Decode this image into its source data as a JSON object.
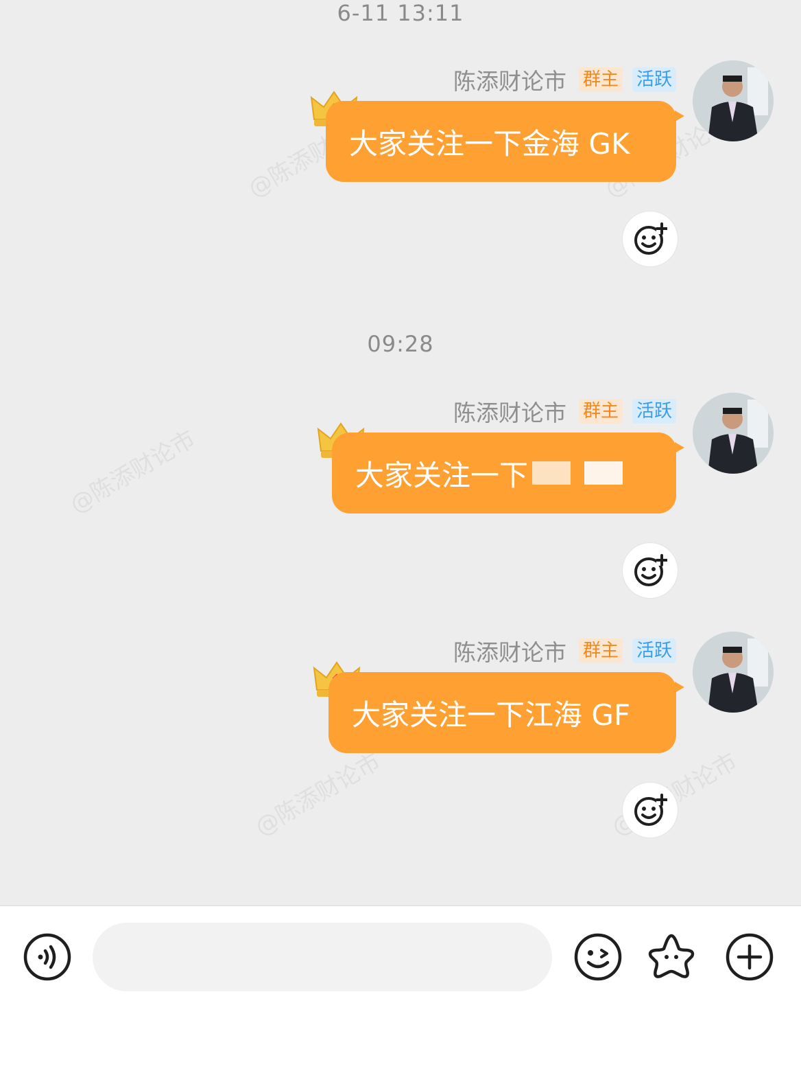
{
  "watermark_text": "@陈添财论市",
  "messages": [
    {
      "time": "6-11 13:11",
      "sender": "陈添财论市",
      "badge_owner": "群主",
      "badge_active": "活跃",
      "text": "大家关注一下金海 GK"
    },
    {
      "time": "09:28",
      "sender": "陈添财论市",
      "badge_owner": "群主",
      "badge_active": "活跃",
      "text": "大家关注一下"
    },
    {
      "sender": "陈添财论市",
      "badge_owner": "群主",
      "badge_active": "活跃",
      "text": "大家关注一下江海 GF"
    }
  ],
  "colors": {
    "bubble": "#ffa033",
    "owner_badge": "#f08a1c",
    "active_badge": "#3a9de6"
  },
  "icons": {
    "react": "emoji-plus-icon",
    "voice": "voice-icon",
    "emoji": "emoji-icon",
    "star": "star-icon",
    "plus": "plus-icon"
  }
}
